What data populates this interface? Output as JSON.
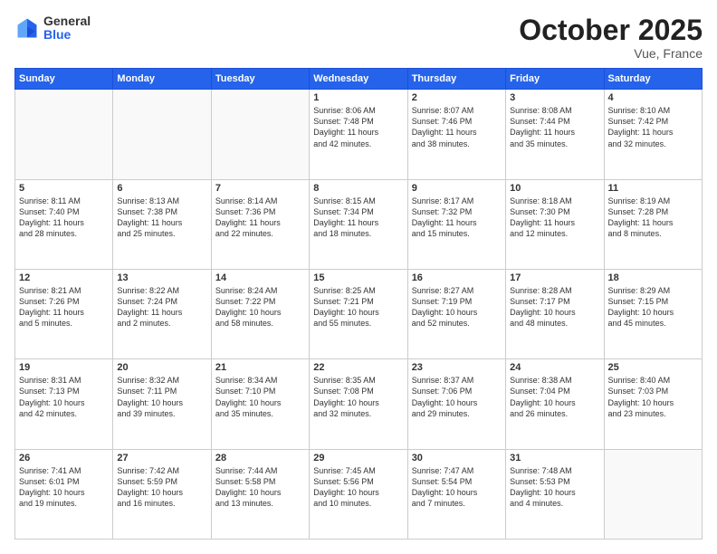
{
  "logo": {
    "general": "General",
    "blue": "Blue"
  },
  "header": {
    "month": "October 2025",
    "location": "Vue, France"
  },
  "weekdays": [
    "Sunday",
    "Monday",
    "Tuesday",
    "Wednesday",
    "Thursday",
    "Friday",
    "Saturday"
  ],
  "weeks": [
    [
      {
        "day": "",
        "info": ""
      },
      {
        "day": "",
        "info": ""
      },
      {
        "day": "",
        "info": ""
      },
      {
        "day": "1",
        "info": "Sunrise: 8:06 AM\nSunset: 7:48 PM\nDaylight: 11 hours\nand 42 minutes."
      },
      {
        "day": "2",
        "info": "Sunrise: 8:07 AM\nSunset: 7:46 PM\nDaylight: 11 hours\nand 38 minutes."
      },
      {
        "day": "3",
        "info": "Sunrise: 8:08 AM\nSunset: 7:44 PM\nDaylight: 11 hours\nand 35 minutes."
      },
      {
        "day": "4",
        "info": "Sunrise: 8:10 AM\nSunset: 7:42 PM\nDaylight: 11 hours\nand 32 minutes."
      }
    ],
    [
      {
        "day": "5",
        "info": "Sunrise: 8:11 AM\nSunset: 7:40 PM\nDaylight: 11 hours\nand 28 minutes."
      },
      {
        "day": "6",
        "info": "Sunrise: 8:13 AM\nSunset: 7:38 PM\nDaylight: 11 hours\nand 25 minutes."
      },
      {
        "day": "7",
        "info": "Sunrise: 8:14 AM\nSunset: 7:36 PM\nDaylight: 11 hours\nand 22 minutes."
      },
      {
        "day": "8",
        "info": "Sunrise: 8:15 AM\nSunset: 7:34 PM\nDaylight: 11 hours\nand 18 minutes."
      },
      {
        "day": "9",
        "info": "Sunrise: 8:17 AM\nSunset: 7:32 PM\nDaylight: 11 hours\nand 15 minutes."
      },
      {
        "day": "10",
        "info": "Sunrise: 8:18 AM\nSunset: 7:30 PM\nDaylight: 11 hours\nand 12 minutes."
      },
      {
        "day": "11",
        "info": "Sunrise: 8:19 AM\nSunset: 7:28 PM\nDaylight: 11 hours\nand 8 minutes."
      }
    ],
    [
      {
        "day": "12",
        "info": "Sunrise: 8:21 AM\nSunset: 7:26 PM\nDaylight: 11 hours\nand 5 minutes."
      },
      {
        "day": "13",
        "info": "Sunrise: 8:22 AM\nSunset: 7:24 PM\nDaylight: 11 hours\nand 2 minutes."
      },
      {
        "day": "14",
        "info": "Sunrise: 8:24 AM\nSunset: 7:22 PM\nDaylight: 10 hours\nand 58 minutes."
      },
      {
        "day": "15",
        "info": "Sunrise: 8:25 AM\nSunset: 7:21 PM\nDaylight: 10 hours\nand 55 minutes."
      },
      {
        "day": "16",
        "info": "Sunrise: 8:27 AM\nSunset: 7:19 PM\nDaylight: 10 hours\nand 52 minutes."
      },
      {
        "day": "17",
        "info": "Sunrise: 8:28 AM\nSunset: 7:17 PM\nDaylight: 10 hours\nand 48 minutes."
      },
      {
        "day": "18",
        "info": "Sunrise: 8:29 AM\nSunset: 7:15 PM\nDaylight: 10 hours\nand 45 minutes."
      }
    ],
    [
      {
        "day": "19",
        "info": "Sunrise: 8:31 AM\nSunset: 7:13 PM\nDaylight: 10 hours\nand 42 minutes."
      },
      {
        "day": "20",
        "info": "Sunrise: 8:32 AM\nSunset: 7:11 PM\nDaylight: 10 hours\nand 39 minutes."
      },
      {
        "day": "21",
        "info": "Sunrise: 8:34 AM\nSunset: 7:10 PM\nDaylight: 10 hours\nand 35 minutes."
      },
      {
        "day": "22",
        "info": "Sunrise: 8:35 AM\nSunset: 7:08 PM\nDaylight: 10 hours\nand 32 minutes."
      },
      {
        "day": "23",
        "info": "Sunrise: 8:37 AM\nSunset: 7:06 PM\nDaylight: 10 hours\nand 29 minutes."
      },
      {
        "day": "24",
        "info": "Sunrise: 8:38 AM\nSunset: 7:04 PM\nDaylight: 10 hours\nand 26 minutes."
      },
      {
        "day": "25",
        "info": "Sunrise: 8:40 AM\nSunset: 7:03 PM\nDaylight: 10 hours\nand 23 minutes."
      }
    ],
    [
      {
        "day": "26",
        "info": "Sunrise: 7:41 AM\nSunset: 6:01 PM\nDaylight: 10 hours\nand 19 minutes."
      },
      {
        "day": "27",
        "info": "Sunrise: 7:42 AM\nSunset: 5:59 PM\nDaylight: 10 hours\nand 16 minutes."
      },
      {
        "day": "28",
        "info": "Sunrise: 7:44 AM\nSunset: 5:58 PM\nDaylight: 10 hours\nand 13 minutes."
      },
      {
        "day": "29",
        "info": "Sunrise: 7:45 AM\nSunset: 5:56 PM\nDaylight: 10 hours\nand 10 minutes."
      },
      {
        "day": "30",
        "info": "Sunrise: 7:47 AM\nSunset: 5:54 PM\nDaylight: 10 hours\nand 7 minutes."
      },
      {
        "day": "31",
        "info": "Sunrise: 7:48 AM\nSunset: 5:53 PM\nDaylight: 10 hours\nand 4 minutes."
      },
      {
        "day": "",
        "info": ""
      }
    ]
  ]
}
